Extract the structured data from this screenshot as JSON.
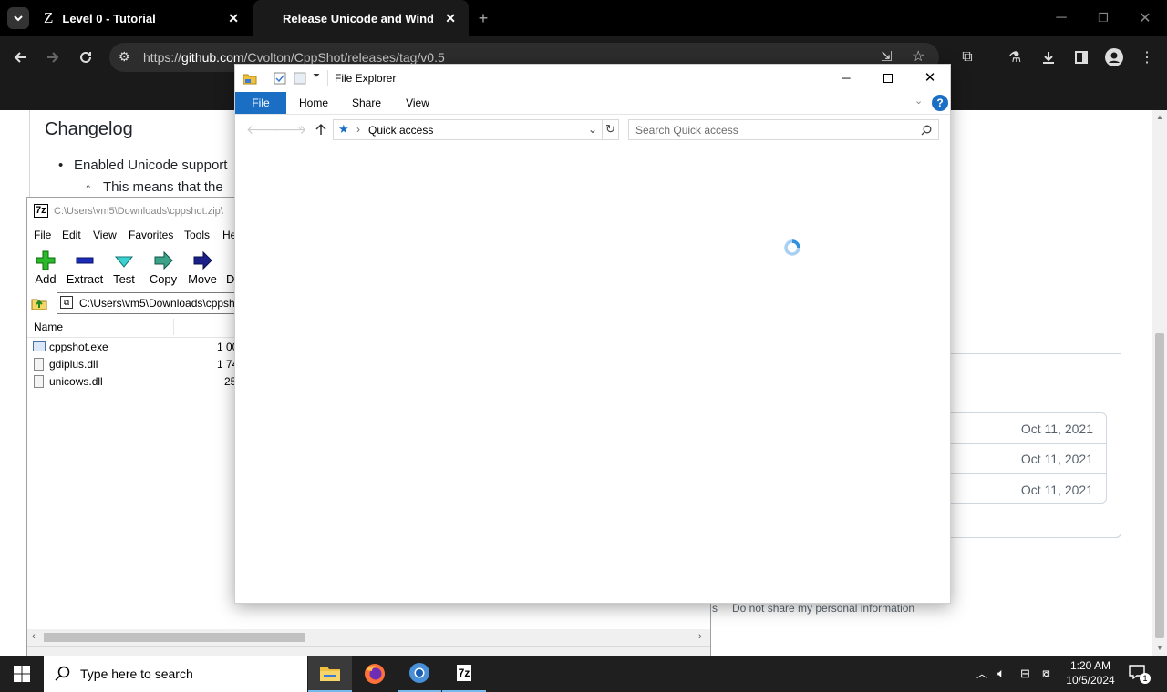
{
  "browser": {
    "tabs": [
      {
        "title": "Level 0 - Tutorial",
        "active": false
      },
      {
        "title": "Release Unicode and Windows",
        "active": true
      }
    ],
    "url_prefix": "https://",
    "url_domain": "github.com",
    "url_path": "/Cvolton/CppShot/releases/tag/v0.5"
  },
  "page": {
    "heading": "Changelog",
    "bullet": "Enabled Unicode support",
    "sub_bullet": "This means that the",
    "asset_dates": [
      "Oct 11, 2021",
      "Oct 11, 2021",
      "Oct 11, 2021"
    ],
    "footer_text": "Do not share my personal information",
    "footer_partial": "s"
  },
  "zip": {
    "title": "C:\\Users\\vm5\\Downloads\\cppshot.zip\\",
    "menu": [
      "File",
      "Edit",
      "View",
      "Favorites",
      "Tools",
      "He"
    ],
    "tools": [
      "Add",
      "Extract",
      "Test",
      "Copy",
      "Move",
      "D"
    ],
    "path": "C:\\Users\\vm5\\Downloads\\cppsh",
    "column_name": "Name",
    "files": [
      {
        "name": "cppshot.exe",
        "size": "1 00"
      },
      {
        "name": "gdiplus.dll",
        "size": "1 74"
      },
      {
        "name": "unicows.dll",
        "size": "25"
      }
    ]
  },
  "explorer": {
    "title": "File Explorer",
    "tabs": [
      "File",
      "Home",
      "Share",
      "View"
    ],
    "location": "Quick access",
    "search_placeholder": "Search Quick access",
    "help_label": "?"
  },
  "taskbar": {
    "search_placeholder": "Type here to search",
    "time": "1:20 AM",
    "date": "10/5/2024",
    "notification_count": "1",
    "zip_label": "7z"
  },
  "colors": {
    "accent": "#0063b1",
    "spinner": "#2f8fe0"
  }
}
